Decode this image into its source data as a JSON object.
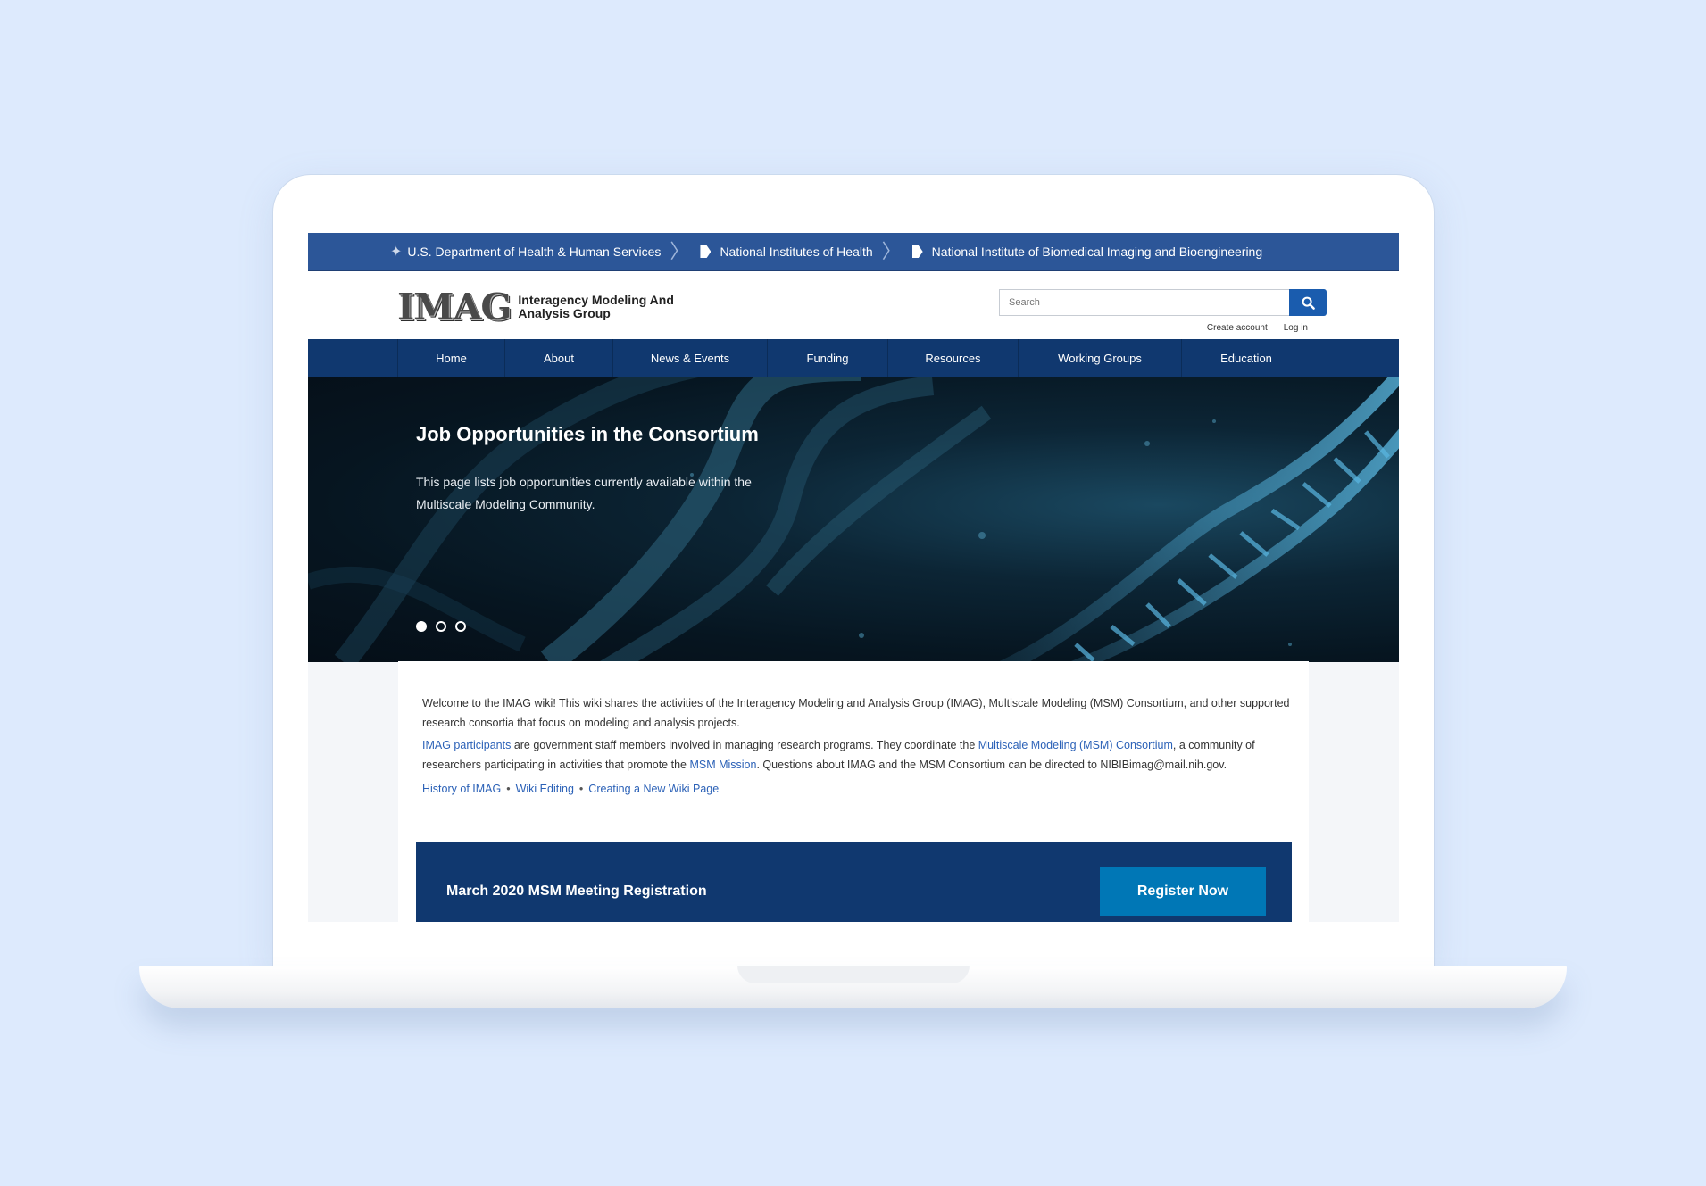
{
  "gov_bar": {
    "hhs": "U.S. Department of Health & Human Services",
    "nih": "National Institutes of Health",
    "nibib": "National Institute of Biomedical Imaging and Bioengineering"
  },
  "header": {
    "logo_mark": "IMAG",
    "logo_text": "Interagency Modeling And Analysis Group",
    "search_placeholder": "Search",
    "create_account": "Create account",
    "log_in": "Log in"
  },
  "nav": {
    "items": [
      "Home",
      "About",
      "News & Events",
      "Funding",
      "Resources",
      "Working Groups",
      "Education"
    ]
  },
  "hero": {
    "title": "Job Opportunities in the Consortium",
    "description": "This page lists job opportunities currently available within the Multiscale Modeling Community.",
    "slide_count": 3,
    "active_slide": 1
  },
  "intro": {
    "welcome": "Welcome to the IMAG wiki! This wiki shares the activities of the Interagency Modeling and Analysis Group (IMAG), Multiscale Modeling (MSM) Consortium, and other supported research consortia that focus on modeling and analysis projects.",
    "participants_link": "IMAG participants",
    "participants_text_1": " are government staff members involved in managing research programs. They coordinate the ",
    "msm_link": "Multiscale Modeling (MSM) Consortium",
    "participants_text_2": ", a community of researchers participating in activities that promote the ",
    "mission_link": "MSM Mission",
    "participants_text_3": ". Questions about IMAG and the MSM Consortium can be directed to NIBIBimag@mail.nih.gov.",
    "links": [
      "History of IMAG",
      "Wiki Editing",
      "Creating a New Wiki Page"
    ]
  },
  "register": {
    "title": "March 2020 MSM Meeting Registration",
    "button": "Register Now"
  },
  "colors": {
    "nav_bg": "#10386f",
    "gov_bar_bg": "#2c5698",
    "link": "#2b61b7",
    "button": "#0077b6"
  }
}
